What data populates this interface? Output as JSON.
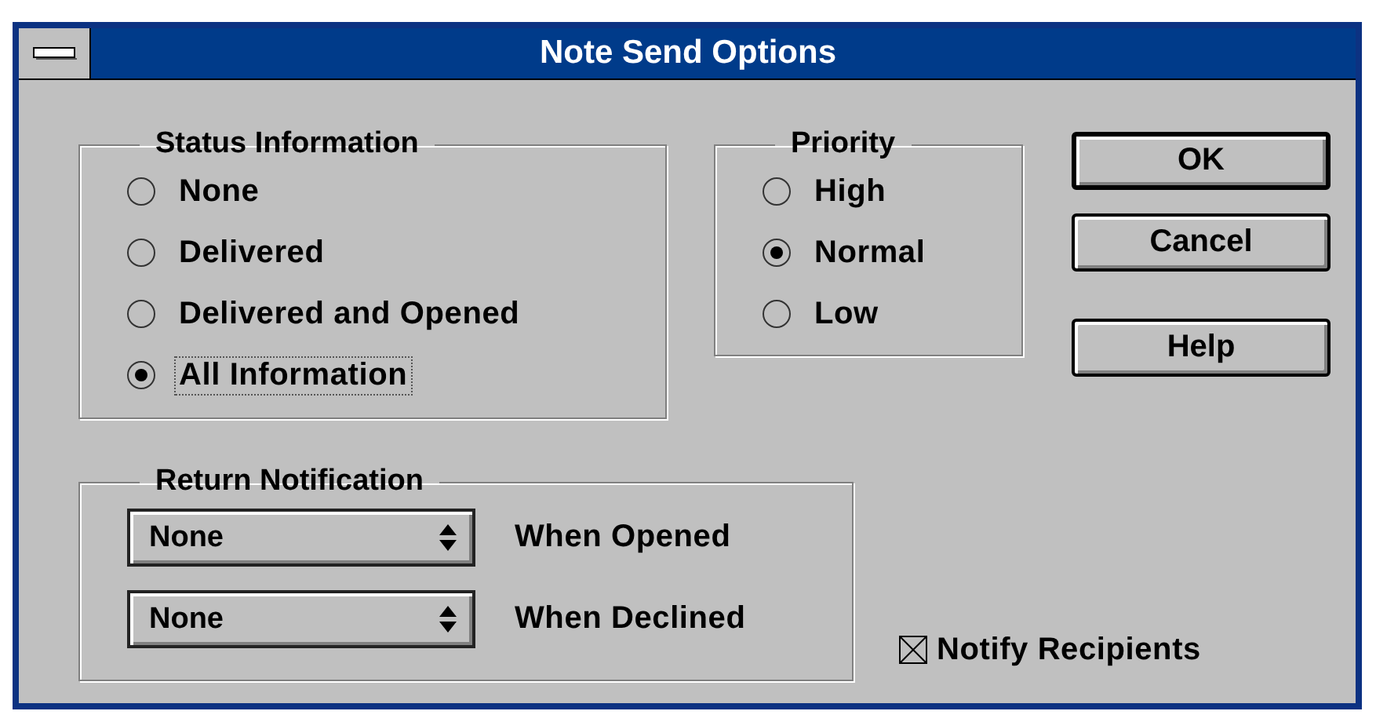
{
  "window": {
    "title": "Note Send Options"
  },
  "status_information": {
    "title": "Status Information",
    "options": [
      {
        "label": "None",
        "selected": false,
        "focused": false
      },
      {
        "label": "Delivered",
        "selected": false,
        "focused": false
      },
      {
        "label": "Delivered and Opened",
        "selected": false,
        "focused": false
      },
      {
        "label": "All Information",
        "selected": true,
        "focused": true
      }
    ]
  },
  "priority": {
    "title": "Priority",
    "options": [
      {
        "label": "High",
        "selected": false,
        "focused": false
      },
      {
        "label": "Normal",
        "selected": true,
        "focused": false
      },
      {
        "label": "Low",
        "selected": false,
        "focused": false
      }
    ]
  },
  "buttons": [
    {
      "label": "OK",
      "default": true
    },
    {
      "label": "Cancel",
      "default": false
    },
    {
      "label": "Help",
      "default": false
    }
  ],
  "return_notification": {
    "title": "Return Notification",
    "rows": [
      {
        "value": "None",
        "label": "When Opened"
      },
      {
        "value": "None",
        "label": "When Declined"
      }
    ]
  },
  "notify_recipients": {
    "label": "Notify Recipients",
    "checked": true
  }
}
